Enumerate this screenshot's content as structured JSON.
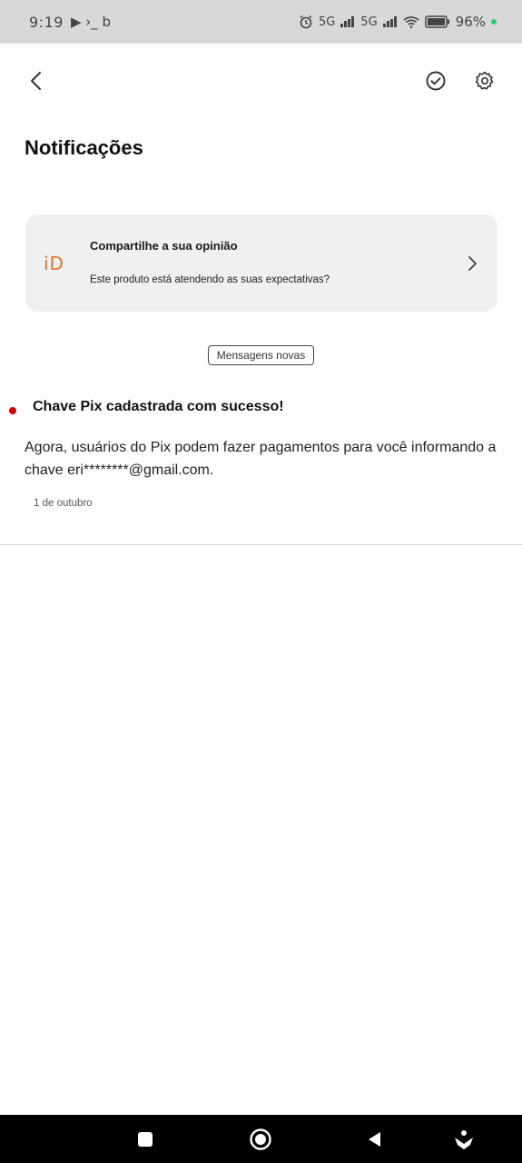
{
  "status_bar": {
    "time": "9:19",
    "left_glyphs": "▶ ›_ b",
    "network_1": "5G",
    "network_2": "5G",
    "battery_text": "96%"
  },
  "header": {
    "title": "Notificações"
  },
  "feedback_card": {
    "logo_text": "iD",
    "title": "Compartilhe a sua opinião",
    "subtitle": "Este produto está atendendo as suas expectativas?"
  },
  "badge": {
    "label": "Mensagens novas"
  },
  "notifications": [
    {
      "title": "Chave Pix cadastrada com sucesso!",
      "body": "Agora, usuários do Pix podem fazer pagamentos para você informando a chave eri********@gmail.com.",
      "date": "1 de outubro",
      "unread": true
    }
  ],
  "icons": {
    "back": "chevron-left-icon",
    "mark_all_read": "check-circle-icon",
    "settings": "gear-icon",
    "card_arrow": "chevron-right-icon"
  },
  "colors": {
    "accent": "#e6742c",
    "unread_dot": "#cc0000",
    "card_bg": "#eef0f2"
  }
}
